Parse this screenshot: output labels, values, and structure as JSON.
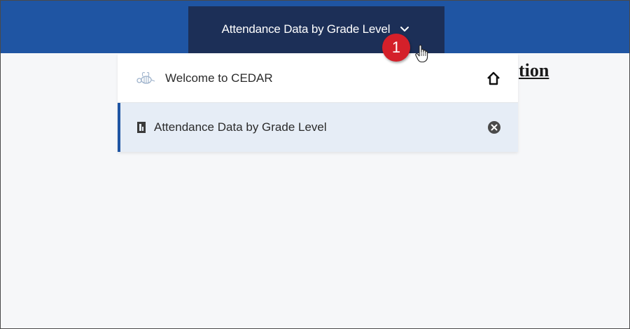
{
  "header": {
    "current_page_label": "Attendance Data by Grade Level"
  },
  "annotation": {
    "step_number": "1"
  },
  "background": {
    "heading_fragment": "tion"
  },
  "dropdown": {
    "items": [
      {
        "label": "Welcome to CEDAR",
        "icon": "bee-icon",
        "action_icon": "home-icon"
      },
      {
        "label": "Attendance Data by Grade Level",
        "icon": "report-icon",
        "action_icon": "close-circle-icon",
        "active": true
      }
    ]
  },
  "colors": {
    "topbar": "#1f55a3",
    "active_tab": "#1c2f57",
    "badge": "#d4202a",
    "active_item_bg": "#e6edf6"
  }
}
